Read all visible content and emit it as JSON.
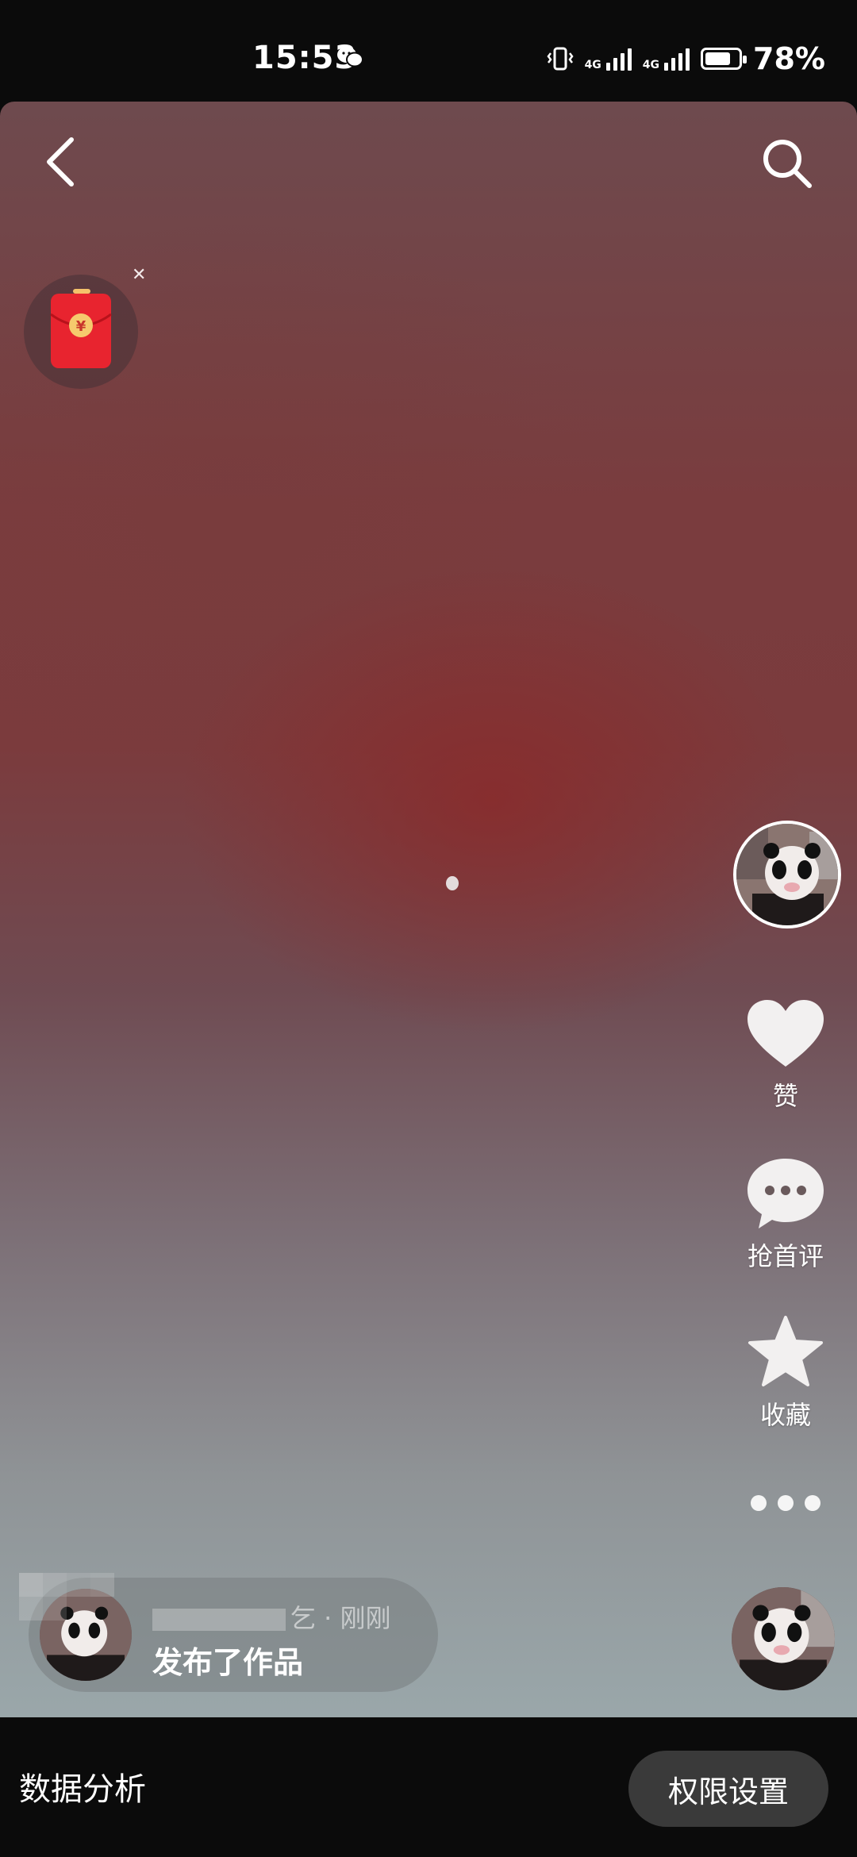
{
  "status_bar": {
    "time": "15:53",
    "network_1": "4G",
    "network_2": "4G",
    "battery_percent": 78,
    "battery_text": "78%"
  },
  "video": {
    "back_icon": "chevron-left-icon",
    "search_icon": "search-icon",
    "red_packet_icon": "red-envelope-icon"
  },
  "actions": {
    "like_label": "赞",
    "comment_label": "抢首评",
    "favorite_label": "收藏"
  },
  "notice": {
    "name_suffix": "乞 · 刚刚",
    "action_text": "发布了作品"
  },
  "bottom": {
    "data_analysis": "数据分析",
    "permission_settings": "权限设置"
  },
  "colors": {
    "accent_red": "#e8242f",
    "background": "#0b0b0b",
    "pill_button": "#3a3a3a"
  }
}
